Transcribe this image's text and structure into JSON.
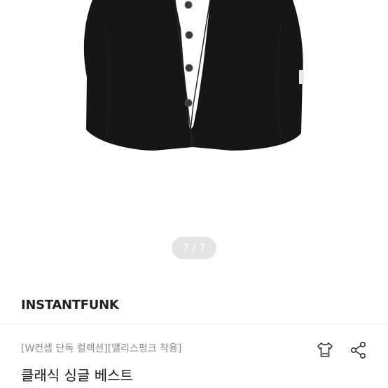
{
  "gallery": {
    "pager": {
      "current": "7",
      "separator": " / ",
      "total": "7"
    },
    "image": {
      "subject": "black single-breasted vest",
      "color": "#111111"
    }
  },
  "product": {
    "brand": "INSTANTFUNK",
    "subtitle": "[W컨셉 단독 컬렉션][앨리스펑크 착용]",
    "title": "클래식 싱글 베스트"
  },
  "actions": {
    "size_icon": "tshirt-size-icon",
    "share_icon": "share-icon"
  },
  "colors": {
    "pager_bg": "#e4e4e6",
    "text_primary": "#1a1a1a",
    "text_secondary": "#8a8a8a",
    "divider": "#ececec"
  }
}
